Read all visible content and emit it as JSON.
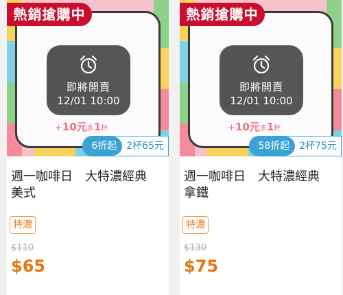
{
  "products": [
    {
      "badge": "熱銷搶購中",
      "overlay_status": "即將開賣",
      "overlay_time": "12/01 10:00",
      "promo_prefix": "+",
      "promo_amount": "10元",
      "promo_mid": "多",
      "promo_count": "1",
      "promo_unit": "杯",
      "discount_label": "6折起",
      "discount_sub": "2杯65元",
      "title": "週一咖啡日　大特濃經典\n美式",
      "tag": "特濃",
      "original_price": "$110",
      "price": "$65",
      "icons": {
        "clock": "alarm-clock-icon"
      },
      "colors": {
        "badge": "#c8102e",
        "price": "#e8750f",
        "discount": "#3aa3d6"
      }
    },
    {
      "badge": "熱銷搶購中",
      "overlay_status": "即將開賣",
      "overlay_time": "12/01 10:00",
      "promo_prefix": "+",
      "promo_amount": "10元",
      "promo_mid": "多",
      "promo_count": "1",
      "promo_unit": "杯",
      "discount_label": "58折起",
      "discount_sub": "2杯75元",
      "title": "週一咖啡日　大特濃經典\n拿鐵",
      "tag": "特濃",
      "original_price": "$130",
      "price": "$75",
      "icons": {
        "clock": "alarm-clock-icon"
      },
      "colors": {
        "badge": "#c8102e",
        "price": "#e8750f",
        "discount": "#3aa3d6"
      }
    }
  ]
}
